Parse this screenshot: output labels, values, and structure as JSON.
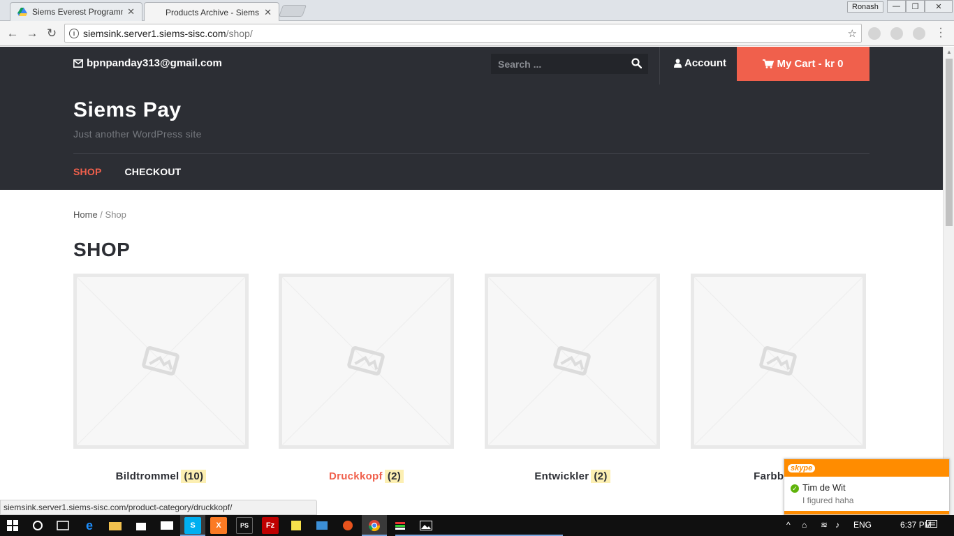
{
  "browser": {
    "tabs": [
      {
        "title": "Siems Everest Programm",
        "active": false
      },
      {
        "title": "Products Archive - Siems",
        "active": true
      }
    ],
    "profile": "Ronash",
    "url_host": "siemsink.server1.siems-sisc.com",
    "url_path": "/shop/",
    "status_url": "siemsink.server1.siems-sisc.com/product-category/druckkopf/"
  },
  "topbar": {
    "email": "bpnpanday313@gmail.com",
    "search_placeholder": "Search ...",
    "account": "Account",
    "cart": "My Cart - kr 0"
  },
  "site": {
    "title": "Siems Pay",
    "tagline": "Just another WordPress site",
    "menu": [
      {
        "label": "SHOP",
        "active": true
      },
      {
        "label": "CHECKOUT",
        "active": false
      }
    ]
  },
  "breadcrumb": {
    "home": "Home",
    "sep": " / ",
    "current": "Shop"
  },
  "page_title": "SHOP",
  "products": [
    {
      "name": "Bildtrommel",
      "count": "(10)",
      "highlight": false
    },
    {
      "name": "Druckkopf",
      "count": "(2)",
      "highlight": true
    },
    {
      "name": "Entwickler",
      "count": "(2)",
      "highlight": false
    },
    {
      "name": "Farbband",
      "count": "",
      "highlight": false
    }
  ],
  "skype": {
    "contact": "Tim de Wit",
    "message": "I figured haha",
    "logo": "skype"
  },
  "taskbar": {
    "lang": "ENG",
    "time": "6:37 PM"
  },
  "colors": {
    "accent": "#f0604c",
    "dark": "#2c2e34",
    "skype": "#ff8c00"
  }
}
